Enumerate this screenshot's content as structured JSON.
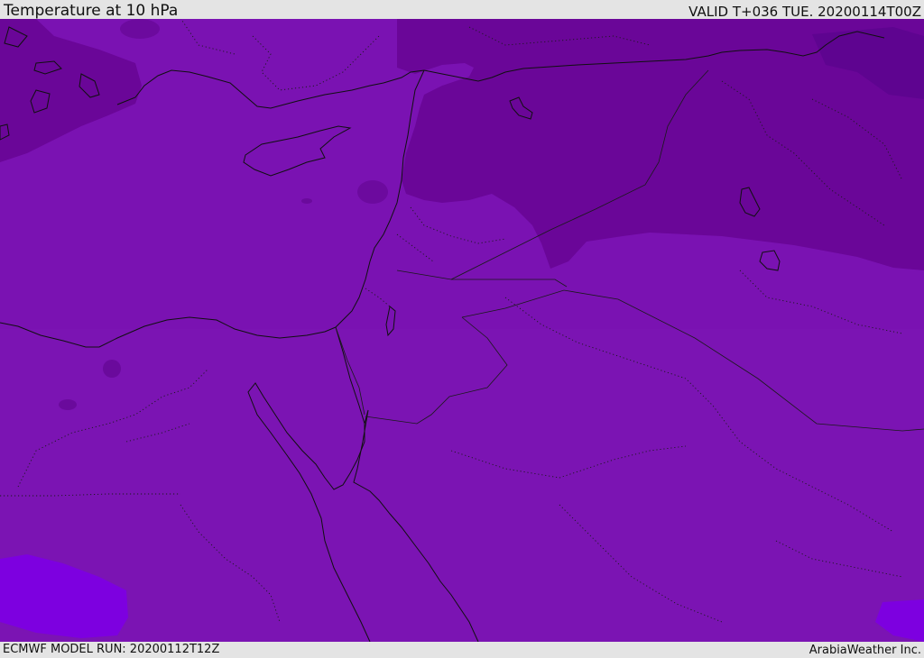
{
  "header": {
    "title": "Temperature at 10 hPa",
    "valid_time": "VALID T+036 TUE. 20200114T00Z"
  },
  "footer": {
    "model_run": "ECMWF MODEL RUN: 20200112T12Z",
    "brand": "ArabiaWeather Inc."
  },
  "colors": {
    "base_field": "#7a12b2",
    "cold_field": "#6a0698",
    "cold_core": "#5e0490",
    "warm_spot": "#7d00e0",
    "coastline": "#101010",
    "frame_bg": "#e4e4e4"
  }
}
